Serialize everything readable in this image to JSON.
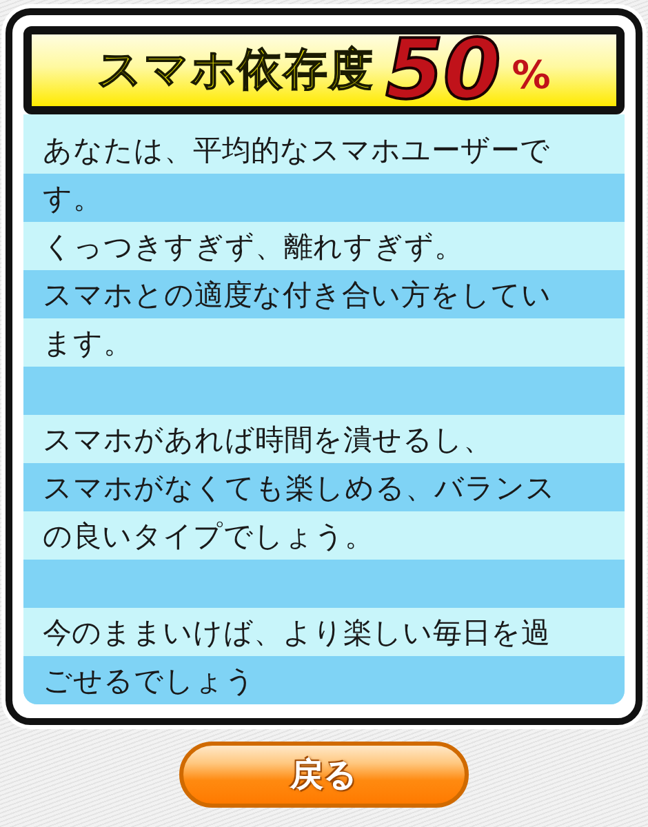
{
  "header": {
    "title": "スマホ依存度",
    "score": "50",
    "unit": "%"
  },
  "paragraphs": [
    {
      "lines": [
        "あなたは、平均的なスマホユーザーで",
        "す。",
        "くっつきすぎず、離れすぎず。",
        "スマホとの適度な付き合い方をしてい",
        "ます。"
      ]
    },
    {
      "lines": [
        "スマホがあれば時間を潰せるし、",
        "スマホがなくても楽しめる、バランス",
        "の良いタイプでしょう。"
      ]
    },
    {
      "lines": [
        "今のままいけば、より楽しい毎日を過",
        "ごせるでしょう"
      ]
    }
  ],
  "button": {
    "label": "戻る"
  }
}
